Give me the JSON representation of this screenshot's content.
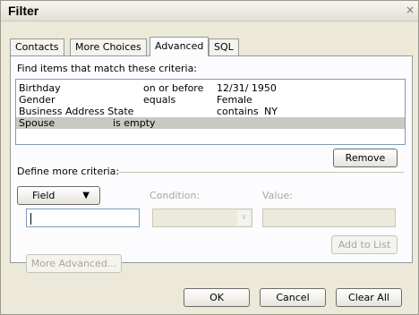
{
  "window": {
    "title": "Filter",
    "close_glyph": "×"
  },
  "tabs": [
    {
      "label": "Contacts"
    },
    {
      "label": "More Choices"
    },
    {
      "label": "Advanced",
      "active": true
    },
    {
      "label": "SQL"
    }
  ],
  "criteria": {
    "heading": "Find items that match these criteria:",
    "rows": [
      {
        "field": "Birthday",
        "condition": "on or before",
        "value": "12/31/ 1950"
      },
      {
        "field": "Gender",
        "condition": "equals",
        "value": "Female"
      },
      {
        "field": "Business Address State",
        "condition": "contains",
        "value": "NY"
      },
      {
        "field": "Spouse",
        "condition": "is empty",
        "value": "",
        "selected": true
      }
    ],
    "remove_label": "Remove"
  },
  "define": {
    "heading": "Define more criteria:",
    "field_button": "Field",
    "field_arrow": "▼",
    "condition_label": "Condition:",
    "value_label": "Value:",
    "add_to_list": "Add to List",
    "more_advanced": "More Advanced...",
    "condition_arrow": "∨"
  },
  "footer": {
    "ok": "OK",
    "cancel": "Cancel",
    "clear_all": "Clear All"
  }
}
